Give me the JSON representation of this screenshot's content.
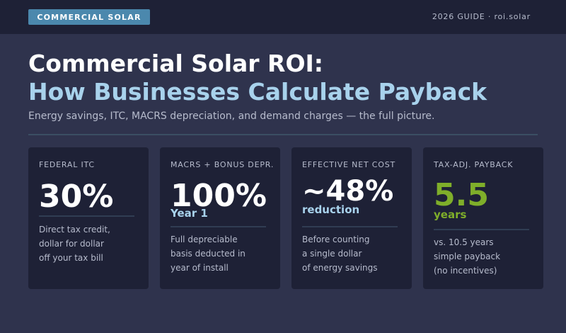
{
  "header": {
    "badge": "COMMERCIAL SOLAR",
    "guide": "2026 GUIDE · roi.solar"
  },
  "hero": {
    "title_line1": "Commercial Solar ROI:",
    "title_line2": "How Businesses Calculate Payback",
    "subtitle": "Energy savings, ITC, MACRS depreciation, and demand charges — the full picture."
  },
  "cards": [
    {
      "label": "FEDERAL ITC",
      "value": "30%",
      "sub": "",
      "desc": [
        "Direct tax credit,",
        "dollar for dollar",
        "off your tax bill"
      ]
    },
    {
      "label": "MACRS + BONUS DEPR.",
      "value": "100%",
      "sub": "Year 1",
      "desc": [
        "Full depreciable",
        "basis deducted in",
        "year of install"
      ]
    },
    {
      "label": "EFFECTIVE NET COST",
      "value": "~48%",
      "sub": "reduction",
      "desc": [
        "Before counting",
        "a single dollar",
        "of energy savings"
      ]
    },
    {
      "label": "TAX-ADJ. PAYBACK",
      "value": "5.5",
      "sub": "years",
      "desc": [
        "vs. 10.5 years",
        "simple payback",
        "(no incentives)"
      ]
    }
  ],
  "colors": {
    "background": "#2f334d",
    "card": "#1e2136",
    "badge": "#4b88ad",
    "title_accent": "#a8d2ec",
    "sub_blue": "#a8d2ec",
    "payback_green": "#7fae2a",
    "text_muted": "#b7bccd"
  }
}
